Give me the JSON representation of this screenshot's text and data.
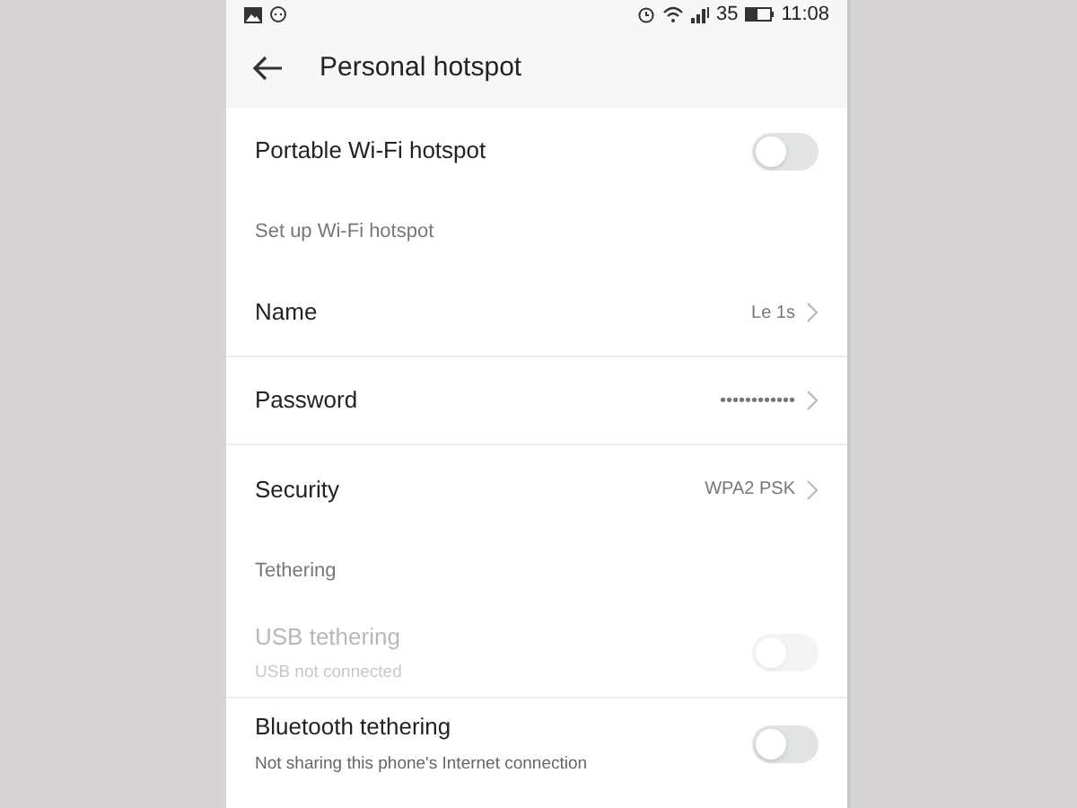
{
  "status_bar": {
    "battery": "35",
    "time": "11:08"
  },
  "header": {
    "title": "Personal hotspot"
  },
  "items": [
    {
      "kind": "toggle",
      "label": "Portable Wi-Fi hotspot",
      "on": false,
      "disabled": false
    },
    {
      "kind": "section",
      "label": "Set up Wi-Fi hotspot"
    },
    {
      "kind": "link",
      "label": "Name",
      "value": "Le 1s"
    },
    {
      "kind": "link",
      "label": "Password",
      "value": "••••••••••••"
    },
    {
      "kind": "link",
      "label": "Security",
      "value": "WPA2 PSK"
    },
    {
      "kind": "section",
      "label": "Tethering"
    },
    {
      "kind": "toggle",
      "label": "USB tethering",
      "subtitle": "USB not connected",
      "on": false,
      "disabled": true
    },
    {
      "kind": "toggle",
      "label": "Bluetooth tethering",
      "subtitle": "Not sharing this phone's Internet connection",
      "on": false,
      "disabled": false
    }
  ]
}
